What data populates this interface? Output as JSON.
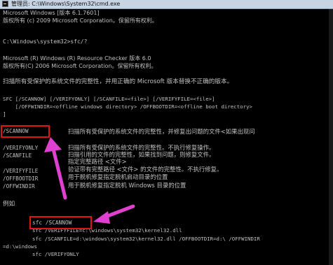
{
  "window": {
    "title": "管理员: C:\\Windows\\System32\\cmd.exe",
    "icon": "cmd-icon"
  },
  "console": {
    "lines": [
      "Microsoft Windows [版本 6.1.7601]",
      "版权所有 (c) 2009 Microsoft Corporation。保留所有权利。",
      "C:\\Windows\\system32>sfc/?",
      "Microsoft (R) Windows (R) Resource Checker 版本 6.0",
      "版权所有(C) 2006 Microsoft Corporation。保留所有权利。",
      "扫描所有受保护的系统文件的完整性，并用正确的 Microsoft 版本替换不正确的版本。",
      "SFC [/SCANNOW] [/VERIFYONLY] [/SCANFILE=<file>] [/VERIFYFILE=<file>]",
      "    [/OFFWINDIR=<offline windows directory> /OFFBOOTDIR=<offline boot directory>",
      "]"
    ],
    "options": [
      {
        "name": "/SCANNOW",
        "desc": "扫描所有受保护的系统文件的完整性，并修复出问题的文件<如果出现问"
      },
      {
        "name": "/VERIFYONLY",
        "desc": "扫描所有受保护的系统文件的完整性。不执行修复操作。"
      },
      {
        "name": "/SCANFILE",
        "desc": "扫描引用的文件的完整性，如果找到问题，则修复文件。"
      },
      {
        "name": "",
        "desc": "指定完整路径 <文件>"
      },
      {
        "name": "/VERIFYFILE",
        "desc": "验证带有完整路径 <文件> 的文件的完整性。不执行修复。"
      },
      {
        "name": "/OFFBOOTDIR",
        "desc": "用于脱机修复指定脱机启动目录的位置"
      },
      {
        "name": "/OFFWINDIR",
        "desc": "用于脱机修复指定脱机 Windows 目录的位置"
      }
    ],
    "example_label": "例如",
    "examples": [
      "sfc /SCANNOW",
      "sfc /VERIFYFILE=c:\\windows\\system32\\kernel32.dll",
      "sfc /SCANFILE=d:\\windows\\system32\\kernel32.dll /OFFBOOTDIR=d:\\ /OFFWINDIR",
      "=d:\\windows",
      "sfc /VERIFYONLY"
    ]
  },
  "colors": {
    "background": "#000000",
    "text": "#c0c0c0",
    "highlight_box": "#e21414",
    "arrow": "#e040d0"
  }
}
